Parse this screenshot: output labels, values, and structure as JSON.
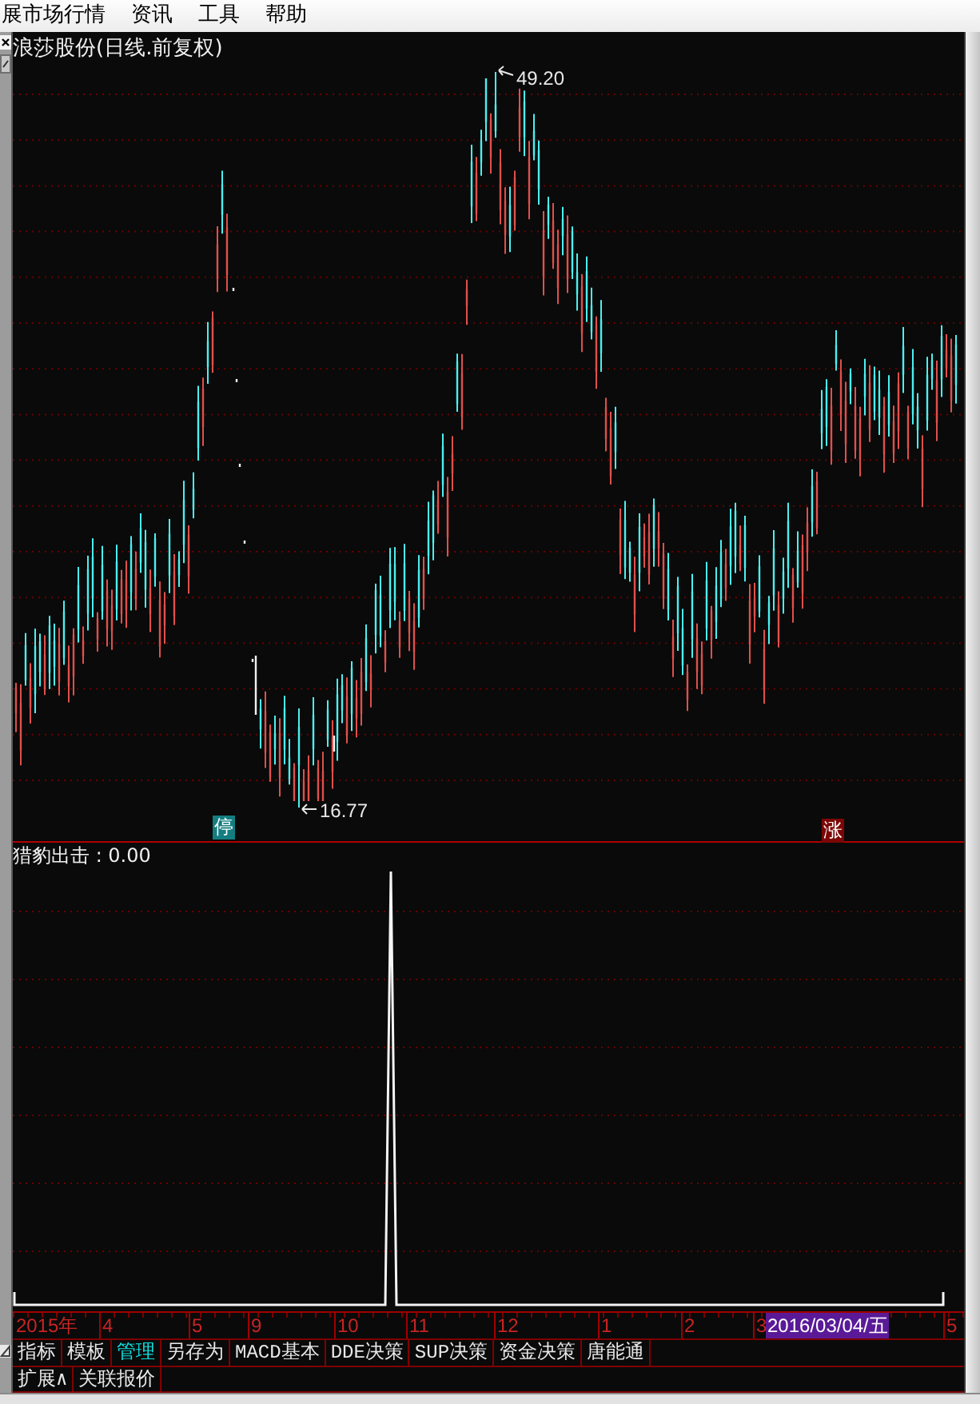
{
  "menu_bar": {
    "items": [
      "展市场行情",
      "资讯",
      "工具",
      "帮助"
    ]
  },
  "chart": {
    "title": "浪莎股份(日线.前复权)",
    "high_label": "49.20",
    "low_label": "16.77",
    "markers": [
      {
        "kind": "halt",
        "text": "停"
      },
      {
        "kind": "limit_up",
        "text": "涨"
      }
    ]
  },
  "indicator": {
    "label": "猎豹出击 : 0.00"
  },
  "date_axis": {
    "labels": [
      "2015年",
      "4",
      "5",
      "9",
      "10",
      "11",
      "12",
      "1",
      "2",
      "3",
      "5"
    ],
    "cursor_date": "2016/03/04/五"
  },
  "tabs": [
    {
      "label": "指标",
      "selected": false
    },
    {
      "label": "模板",
      "selected": false
    },
    {
      "label": "管理",
      "selected": true
    },
    {
      "label": "另存为",
      "selected": false
    },
    {
      "label": "MACD基本",
      "selected": false
    },
    {
      "label": "DDE决策",
      "selected": false
    },
    {
      "label": "SUP决策",
      "selected": false
    },
    {
      "label": "资金决策",
      "selected": false
    },
    {
      "label": "唐能通",
      "selected": false
    }
  ],
  "bottom_tabs": [
    "扩展∧",
    "关联报价"
  ]
}
